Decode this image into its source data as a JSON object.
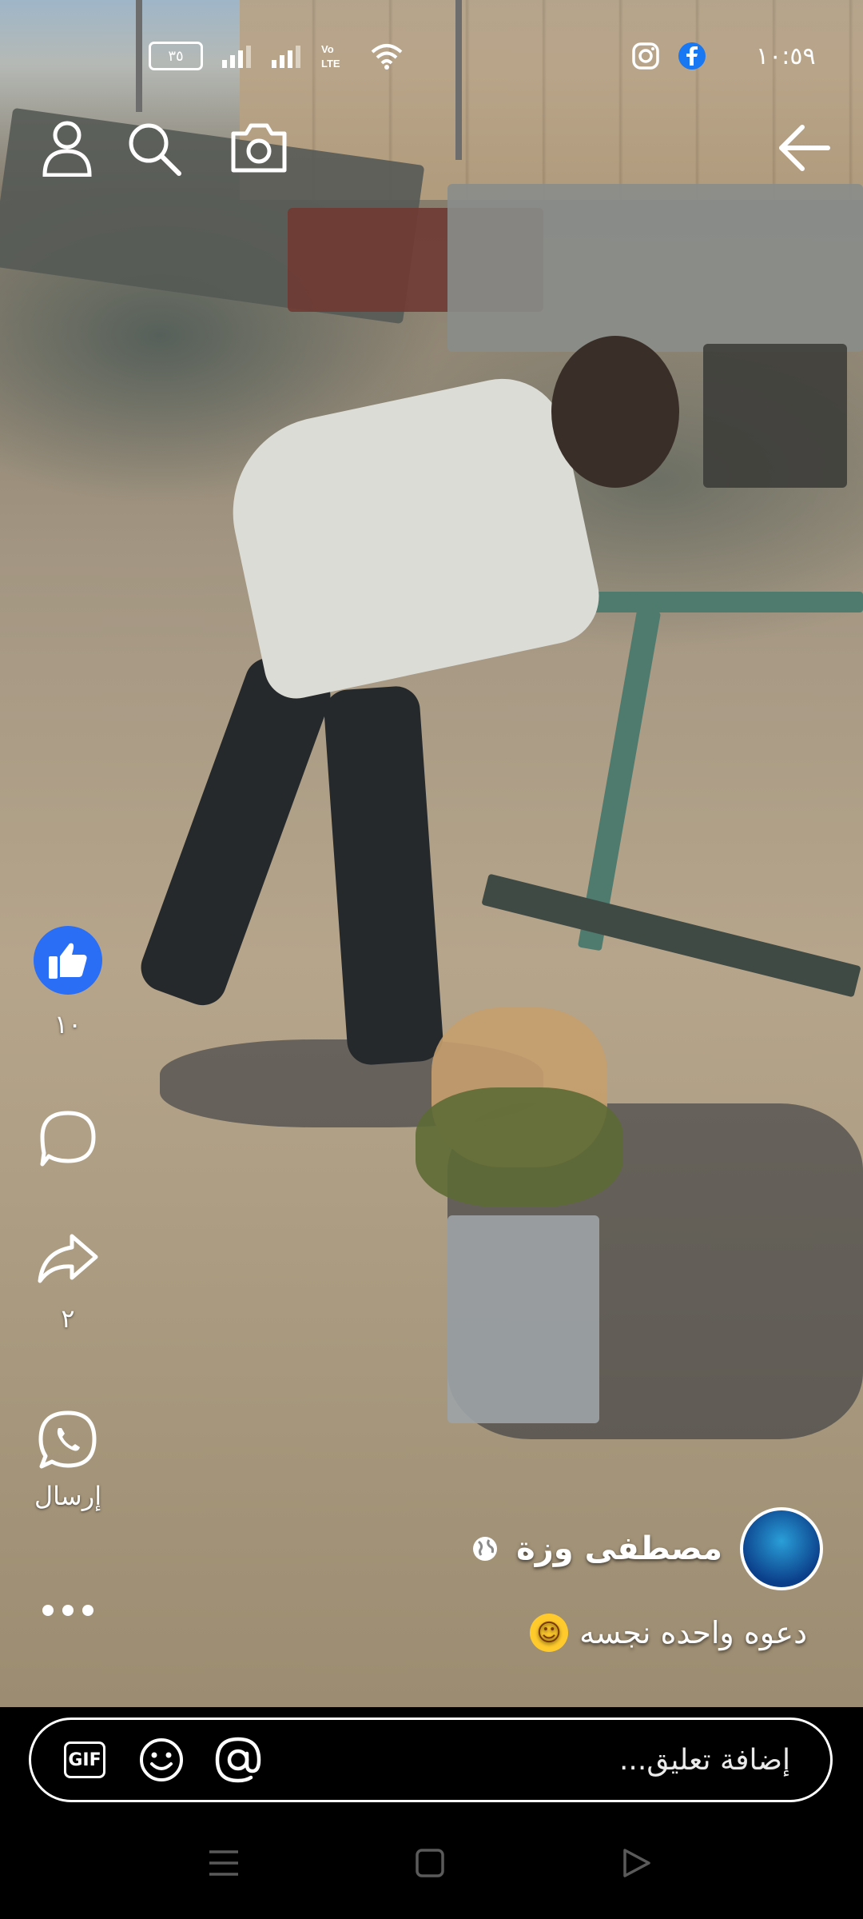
{
  "status_bar": {
    "battery": "٣٥",
    "network_label": "Vo LTE2",
    "time": "١٠:٥٩",
    "signal_icons": [
      "signal-bars-icon",
      "signal-bars-icon",
      "wifi-icon"
    ],
    "notification_icons": [
      "instagram-icon",
      "facebook-icon"
    ]
  },
  "top_bar": {
    "icons": [
      "profile-icon",
      "search-icon",
      "camera-icon",
      "back-arrow-icon"
    ]
  },
  "actions": {
    "like_count": "١٠",
    "share_count": "٢",
    "send_label": "إرسال",
    "icons": [
      "like-icon",
      "comment-icon",
      "share-icon",
      "whatsapp-icon",
      "more-icon"
    ],
    "like_color": "#2A6EF5"
  },
  "post": {
    "author_name": "مصطفى وزة",
    "privacy_icon": "globe-icon",
    "caption": "دعوه واحده نجسه",
    "caption_emoji": "rolling-on-floor-laughing-icon"
  },
  "comment_bar": {
    "placeholder": "إضافة تعليق...",
    "gif_label": "GIF",
    "icons": [
      "gif-icon",
      "emoji-icon",
      "mention-icon"
    ]
  },
  "nav_bar": {
    "icons": [
      "menu-icon",
      "home-icon",
      "back-icon"
    ]
  }
}
